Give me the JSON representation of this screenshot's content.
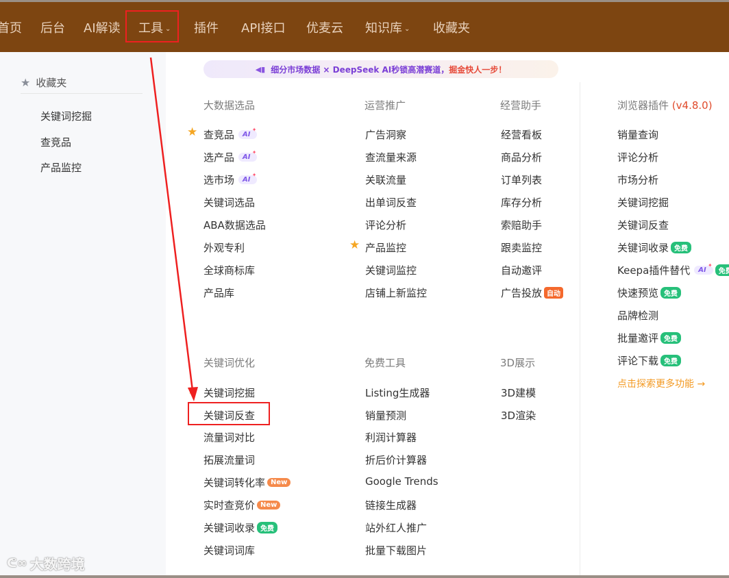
{
  "nav": {
    "items": [
      "首页",
      "后台",
      "AI解读",
      "工具",
      "插件",
      "API接口",
      "优麦云",
      "知识库",
      "收藏夹"
    ],
    "caret": "⌄"
  },
  "sidebar": {
    "header": "收藏夹",
    "items": [
      "关键词挖掘",
      "查竞品",
      "产品监控"
    ]
  },
  "banner": {
    "text": "细分市场数据 × DeepSeek AI秒锁高潜赛道，",
    "highlight": "掘金快人一步！"
  },
  "badges": {
    "ai": "AI",
    "new": "New",
    "free": "免费",
    "auto": "自动"
  },
  "columns": {
    "big_data": {
      "title": "大数据选品",
      "items": [
        "查竞品",
        "选产品",
        "选市场",
        "关键词选品",
        "ABA数据选品",
        "外观专利",
        "全球商标库",
        "产品库"
      ]
    },
    "marketing": {
      "title": "运营推广",
      "items": [
        "广告洞察",
        "查流量来源",
        "关联流量",
        "出单词反查",
        "评论分析",
        "产品监控",
        "关键词监控",
        "店铺上新监控"
      ]
    },
    "assistant": {
      "title": "经营助手",
      "items": [
        "经营看板",
        "商品分析",
        "订单列表",
        "库存分析",
        "索赔助手",
        "跟卖监控",
        "自动邀评",
        "广告投放"
      ]
    },
    "plugin": {
      "title": "浏览器插件",
      "version": "(v4.8.0)",
      "items": [
        "销量查询",
        "评论分析",
        "市场分析",
        "关键词挖掘",
        "关键词反查",
        "关键词收录",
        "Keepa插件替代",
        "快速预览",
        "品牌检测",
        "批量邀评",
        "评论下载"
      ],
      "explore": "点击探索更多功能 →"
    },
    "keyword": {
      "title": "关键词优化",
      "items": [
        "关键词挖掘",
        "关键词反查",
        "流量词对比",
        "拓展流量词",
        "关键词转化率",
        "实时查竞价",
        "关键词收录",
        "关键词词库"
      ]
    },
    "free": {
      "title": "免费工具",
      "items": [
        "Listing生成器",
        "销量预测",
        "利润计算器",
        "折后价计算器",
        "Google Trends",
        "链接生成器",
        "站外红人推广",
        "批量下载图片"
      ]
    },
    "three_d": {
      "title": "3D展示",
      "items": [
        "3D建模",
        "3D渲染"
      ]
    }
  },
  "watermark": "大数跨境",
  "colors": {
    "nav_bg": "#7d4511",
    "nav_text": "#e9d2bd",
    "annotation_red": "#ee2020",
    "star_yellow": "#f5a623",
    "explore_orange": "#f39a23"
  }
}
